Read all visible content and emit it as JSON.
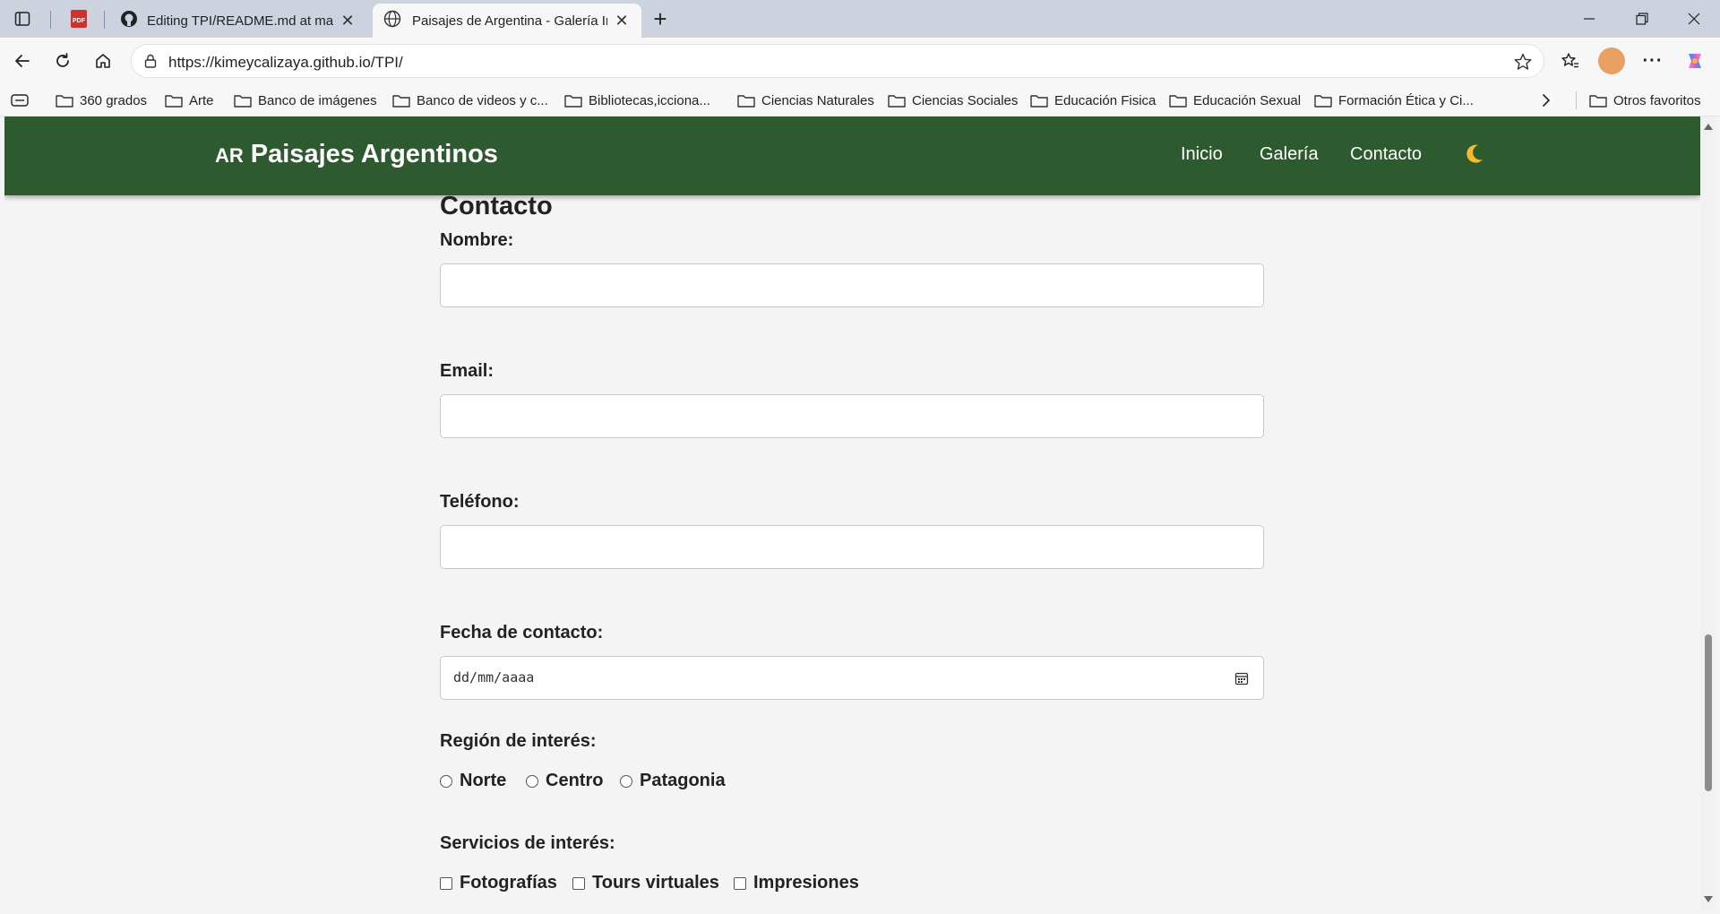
{
  "browser": {
    "tabs": [
      {
        "title": "",
        "kind": "pdf"
      },
      {
        "title": "Editing TPI/README.md at main ·",
        "kind": "github"
      },
      {
        "title": "Paisajes de Argentina - Galería Int",
        "kind": "globe",
        "active": true
      }
    ],
    "url": "https://kimeycalizaya.github.io/TPI/",
    "bookmarks": [
      "360 grados",
      "Arte",
      "Banco de imágenes",
      "Banco de videos y c...",
      "Bibliotecas,icciona...",
      "Ciencias Naturales",
      "Ciencias Sociales",
      "Educación Fisica",
      "Educación Sexual",
      "Formación Ética y Ci...",
      "Otros favoritos"
    ]
  },
  "site": {
    "flag": "AR",
    "brand": "Paisajes Argentinos",
    "nav": [
      "Inicio",
      "Galería",
      "Contacto"
    ],
    "theme_icon": "moon-icon"
  },
  "form": {
    "title": "Contacto",
    "name_label": "Nombre:",
    "email_label": "Email:",
    "phone_label": "Teléfono:",
    "date_label": "Fecha de contacto:",
    "date_placeholder": "dd/mm/aaaa",
    "region_label": "Región de interés:",
    "regions": [
      "Norte",
      "Centro",
      "Patagonia"
    ],
    "services_label": "Servicios de interés:",
    "services": [
      "Fotografías",
      "Tours virtuales",
      "Impresiones"
    ]
  },
  "colors": {
    "header_bg": "#2e5a30",
    "page_bg": "#f4f4f4"
  }
}
